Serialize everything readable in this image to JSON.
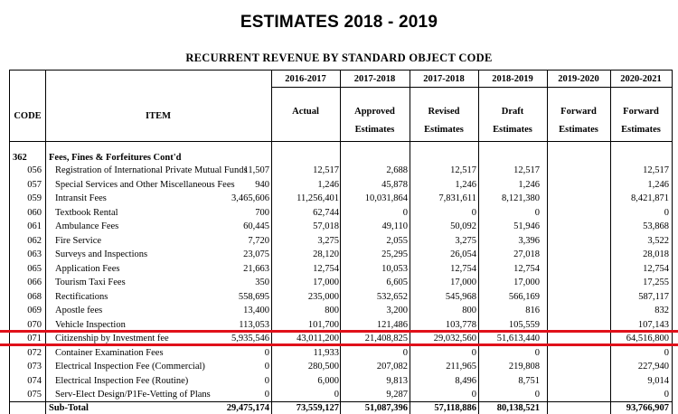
{
  "document": {
    "title": "ESTIMATES 2018 - 2019",
    "subtitle": "RECURRENT REVENUE BY STANDARD OBJECT CODE"
  },
  "table": {
    "header_code": "CODE",
    "header_item": "ITEM",
    "columns": [
      {
        "year": "2016-2017",
        "line1": "Actual",
        "line2": ""
      },
      {
        "year": "2017-2018",
        "line1": "Approved",
        "line2": "Estimates"
      },
      {
        "year": "2017-2018",
        "line1": "Revised",
        "line2": "Estimates"
      },
      {
        "year": "2018-2019",
        "line1": "Draft",
        "line2": "Estimates"
      },
      {
        "year": "2019-2020",
        "line1": "Forward",
        "line2": "Estimates"
      },
      {
        "year": "2020-2021",
        "line1": "Forward",
        "line2": "Estimates"
      }
    ],
    "section": {
      "code": "362",
      "label": "Fees, Fines & Forfeitures Cont'd"
    },
    "rows": [
      {
        "code": "056",
        "item": "Registration of International Private Mutual Funds",
        "values": [
          "11,507",
          "12,517",
          "2,688",
          "12,517",
          "12,517",
          "12,517"
        ]
      },
      {
        "code": "057",
        "item": "Special Services and Other Miscellaneous Fees",
        "values": [
          "940",
          "1,246",
          "45,878",
          "1,246",
          "1,246",
          "1,246"
        ]
      },
      {
        "code": "059",
        "item": "Intransit Fees",
        "values": [
          "3,465,606",
          "11,256,401",
          "10,031,864",
          "7,831,611",
          "8,121,380",
          "8,421,871"
        ]
      },
      {
        "code": "060",
        "item": "Textbook Rental",
        "values": [
          "700",
          "62,744",
          "0",
          "0",
          "0",
          "0"
        ]
      },
      {
        "code": "061",
        "item": "Ambulance Fees",
        "values": [
          "60,445",
          "57,018",
          "49,110",
          "50,092",
          "51,946",
          "53,868"
        ]
      },
      {
        "code": "062",
        "item": "Fire Service",
        "values": [
          "7,720",
          "3,275",
          "2,055",
          "3,275",
          "3,396",
          "3,522"
        ]
      },
      {
        "code": "063",
        "item": "Surveys and Inspections",
        "values": [
          "23,075",
          "28,120",
          "25,295",
          "26,054",
          "27,018",
          "28,018"
        ]
      },
      {
        "code": "065",
        "item": "Application Fees",
        "values": [
          "21,663",
          "12,754",
          "10,053",
          "12,754",
          "12,754",
          "12,754"
        ]
      },
      {
        "code": "066",
        "item": "Tourism Taxi Fees",
        "values": [
          "350",
          "17,000",
          "6,605",
          "17,000",
          "17,000",
          "17,255"
        ]
      },
      {
        "code": "068",
        "item": "Rectifications",
        "values": [
          "558,695",
          "235,000",
          "532,652",
          "545,968",
          "566,169",
          "587,117"
        ]
      },
      {
        "code": "069",
        "item": "Apostle fees",
        "values": [
          "13,400",
          "800",
          "3,200",
          "800",
          "816",
          "832"
        ]
      },
      {
        "code": "070",
        "item": "Vehicle Inspection",
        "values": [
          "113,053",
          "101,700",
          "121,486",
          "103,778",
          "105,559",
          "107,143"
        ]
      },
      {
        "code": "071",
        "item": "Citizenship by Investment fee",
        "values": [
          "5,935,546",
          "43,011,200",
          "21,408,825",
          "29,032,560",
          "51,613,440",
          "64,516,800"
        ]
      },
      {
        "code": "072",
        "item": "Container Examination Fees",
        "values": [
          "0",
          "11,933",
          "0",
          "0",
          "0",
          "0"
        ]
      },
      {
        "code": "073",
        "item": "Electrical Inspection Fee (Commercial)",
        "values": [
          "0",
          "280,500",
          "207,082",
          "211,965",
          "219,808",
          "227,940"
        ]
      },
      {
        "code": "074",
        "item": "Electrical Inspection Fee (Routine)",
        "values": [
          "0",
          "6,000",
          "9,813",
          "8,496",
          "8,751",
          "9,014"
        ]
      },
      {
        "code": "075",
        "item": "Serv-Elect Design/P1Fe-Vetting of Plans",
        "values": [
          "0",
          "0",
          "9,287",
          "0",
          "0",
          "0"
        ]
      }
    ],
    "subtotal": {
      "label": "Sub-Total",
      "values": [
        "29,475,174",
        "73,559,127",
        "51,087,396",
        "57,118,886",
        "80,138,521",
        "93,766,907"
      ]
    },
    "highlight_color": "#e0101a"
  }
}
